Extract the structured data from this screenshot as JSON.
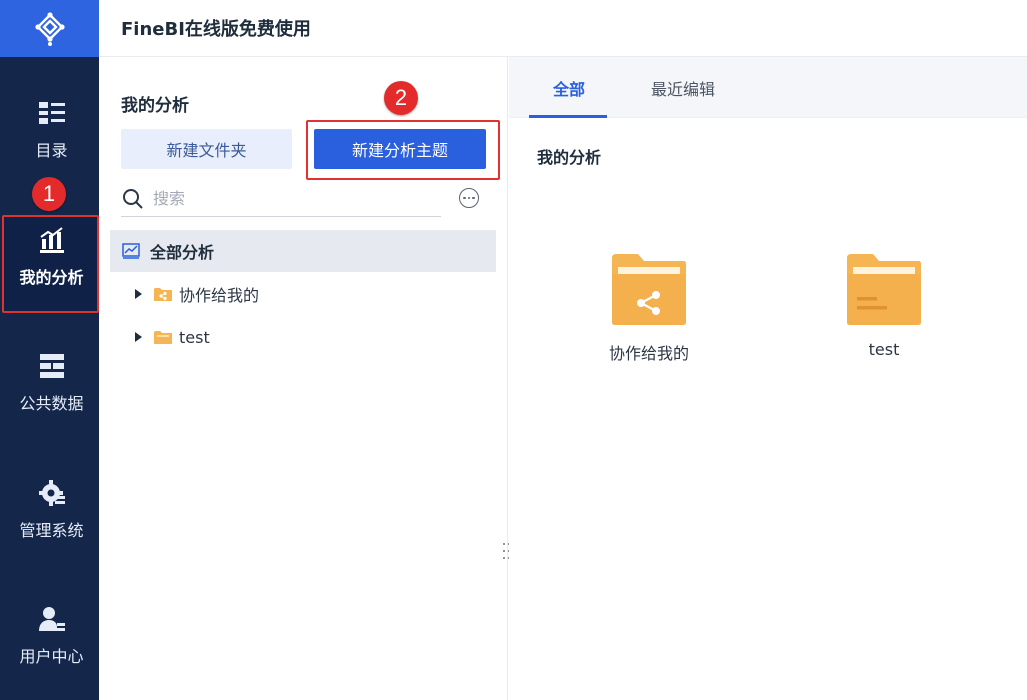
{
  "app_title": "FineBI在线版免费使用",
  "sidebar": {
    "logo_icon": "finebi-logo-icon",
    "items": [
      {
        "label": "目录",
        "icon": "catalog-icon"
      },
      {
        "label": "我的分析",
        "icon": "my-analysis-icon",
        "active": true
      },
      {
        "label": "公共数据",
        "icon": "public-data-icon"
      },
      {
        "label": "管理系统",
        "icon": "gear-icon"
      },
      {
        "label": "用户中心",
        "icon": "user-icon"
      }
    ]
  },
  "annotations": {
    "step1": "1",
    "step2": "2",
    "highlight_color": "#e0332f"
  },
  "left_panel": {
    "title": "我的分析",
    "new_folder_label": "新建文件夹",
    "new_subject_label": "新建分析主题",
    "search_placeholder": "搜索",
    "tree": {
      "root_label": "全部分析",
      "items": [
        {
          "label": "协作给我的",
          "icon": "shared-folder-icon"
        },
        {
          "label": "test",
          "icon": "folder-icon"
        }
      ]
    }
  },
  "content": {
    "tabs": [
      {
        "label": "全部",
        "active": true
      },
      {
        "label": "最近编辑",
        "active": false
      }
    ],
    "section_title": "我的分析",
    "cards": [
      {
        "label": "协作给我的",
        "icon": "shared-folder-icon"
      },
      {
        "label": "test",
        "icon": "folder-icon"
      }
    ]
  },
  "colors": {
    "sidebar_bg": "#14264a",
    "accent": "#2a5fde",
    "logo_bg": "#2f64e0",
    "folder": "#f5b553"
  }
}
